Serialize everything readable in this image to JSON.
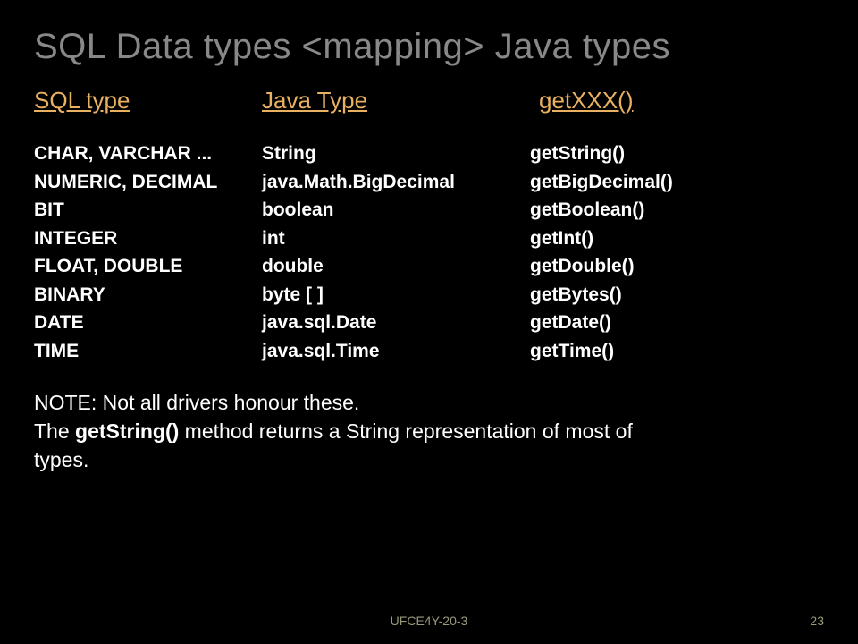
{
  "title": "SQL Data types <mapping> Java types",
  "headers": {
    "col1": "SQL  type",
    "col2": "Java Type",
    "col3": "getXXX()"
  },
  "chart_data": {
    "type": "table",
    "columns": [
      "SQL type",
      "Java Type",
      "getXXX()"
    ],
    "rows": [
      [
        "CHAR, VARCHAR ...",
        "String",
        "getString()"
      ],
      [
        "NUMERIC, DECIMAL",
        "java.Math.BigDecimal",
        "getBigDecimal()"
      ],
      [
        "BIT",
        "boolean",
        "getBoolean()"
      ],
      [
        "INTEGER",
        "int",
        "getInt()"
      ],
      [
        "FLOAT, DOUBLE",
        "double",
        "getDouble()"
      ],
      [
        "BINARY",
        "byte [ ]",
        "getBytes()"
      ],
      [
        "DATE",
        "java.sql.Date",
        "getDate()"
      ],
      [
        "TIME",
        "java.sql.Time",
        "getTime()"
      ]
    ]
  },
  "note": {
    "line1": "NOTE: Not all drivers honour these.",
    "line2_prefix": "The ",
    "line2_bold": "getString()",
    "line2_suffix": " method returns a String representation of most of",
    "line3": "types."
  },
  "footer": "UFCE4Y-20-3",
  "slide_number": "23"
}
